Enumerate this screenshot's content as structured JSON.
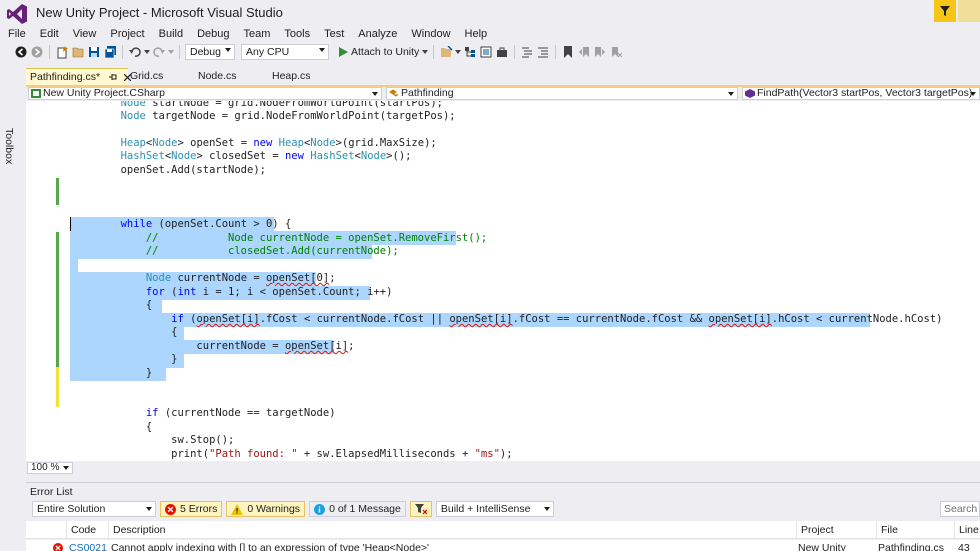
{
  "window": {
    "title": "New Unity Project - Microsoft Visual Studio"
  },
  "menu": [
    "File",
    "Edit",
    "View",
    "Project",
    "Build",
    "Debug",
    "Team",
    "Tools",
    "Test",
    "Analyze",
    "Window",
    "Help"
  ],
  "toolbar": {
    "config": "Debug",
    "platform": "Any CPU",
    "attach_label": "Attach to Unity"
  },
  "sidebar": {
    "toolbox_label": "Toolbox"
  },
  "tabs": [
    {
      "label": "Pathfinding.cs*",
      "active": true
    },
    {
      "label": "Grid.cs",
      "active": false
    },
    {
      "label": "Node.cs",
      "active": false
    },
    {
      "label": "Heap.cs",
      "active": false
    }
  ],
  "navbar": {
    "project": "New Unity Project.CSharp",
    "class": "Pathfinding",
    "member": "FindPath(Vector3 startPos, Vector3 targetPos)"
  },
  "code_lines": [
    "        Node startNode = grid.NodeFromWorldPoint(startPos);",
    "        Node targetNode = grid.NodeFromWorldPoint(targetPos);",
    "",
    "        Heap<Node> openSet = new Heap<Node>(grid.MaxSize);",
    "        HashSet<Node> closedSet = new HashSet<Node>();",
    "        openSet.Add(startNode);",
    "",
    "",
    "",
    "        while (openSet.Count > 0) {",
    "            //           Node currentNode = openSet.RemoveFirst();",
    "            //           closedSet.Add(currentNode);",
    "",
    "            Node currentNode = openSet[0];",
    "            for (int i = 1; i < openSet.Count; i++)",
    "            {",
    "                if (openSet[i].fCost < currentNode.fCost || openSet[i].fCost == currentNode.fCost && openSet[i].hCost < currentNode.hCost)",
    "                {",
    "                    currentNode = openSet[i];",
    "                }",
    "            }",
    "",
    "",
    "            if (currentNode == targetNode)",
    "            {",
    "                sw.Stop();",
    "                print(\"Path found: \" + sw.ElapsedMilliseconds + \"ms\");"
  ],
  "zoom": "100 %",
  "error_list": {
    "title": "Error List",
    "scope": "Entire Solution",
    "errors": "5 Errors",
    "warnings": "0 Warnings",
    "messages": "0 of 1 Message",
    "build_filter": "Build + IntelliSense",
    "search_placeholder": "Search E",
    "columns": [
      "Code",
      "Description",
      "Project",
      "File",
      "Line"
    ],
    "rows": [
      {
        "code": "CS0021",
        "description": "Cannot apply indexing with [] to an expression of type 'Heap<Node>'",
        "project": "New Unity",
        "file": "Pathfinding.cs",
        "line": "43"
      }
    ]
  },
  "colors": {
    "keyword": "#0000ff",
    "type": "#2b91af",
    "comment": "#008000",
    "string": "#a31515",
    "selection": "#add6ff",
    "vs_purple": "#68217a"
  }
}
